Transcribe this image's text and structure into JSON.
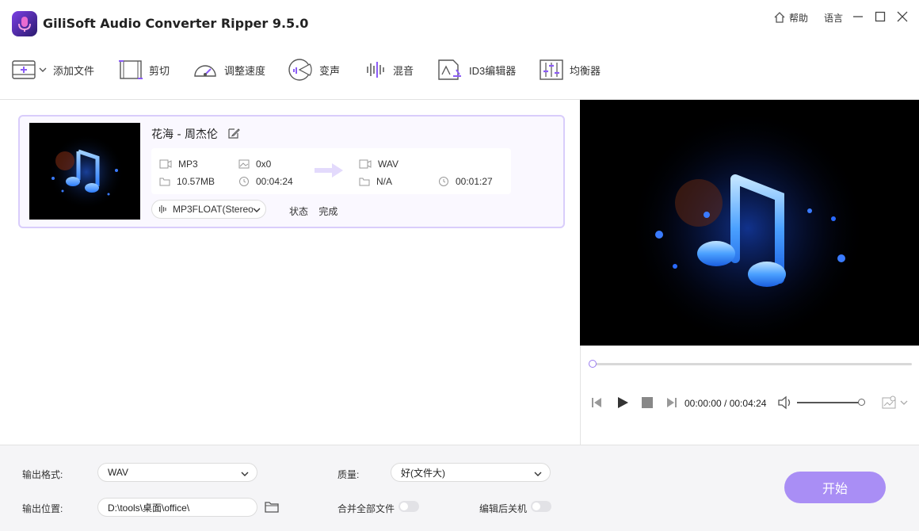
{
  "app": {
    "title": "GiliSoft Audio Converter Ripper 9.5.0",
    "help_label": "帮助",
    "language_label": "语言"
  },
  "toolbar": {
    "add_file": "添加文件",
    "cut": "剪切",
    "speed": "调整速度",
    "voice_change": "变声",
    "mix": "混音",
    "id3_editor": "ID3编辑器",
    "equalizer": "均衡器"
  },
  "file": {
    "name": "花海 - 周杰伦",
    "source_format": "MP3",
    "resolution": "0x0",
    "size": "10.57MB",
    "duration": "00:04:24",
    "target_format": "WAV",
    "target_size": "N/A",
    "target_duration": "00:01:27",
    "audio_track": "MP3FLOAT(Stereo)",
    "status_label": "状态",
    "status_value": "完成"
  },
  "player": {
    "time": "00:00:00 / 00:04:24",
    "progress": 0,
    "volume": 1.0
  },
  "bottom": {
    "format_label": "输出格式:",
    "format_value": "WAV",
    "quality_label": "质量:",
    "quality_value": "好(文件大)",
    "location_label": "输出位置:",
    "location_value": "D:\\tools\\桌面\\office\\",
    "merge_label": "合并全部文件",
    "shutdown_label": "编辑后关机",
    "start_label": "开始"
  },
  "colors": {
    "accent": "#a98ef5",
    "card_border": "#d9cdfb"
  }
}
